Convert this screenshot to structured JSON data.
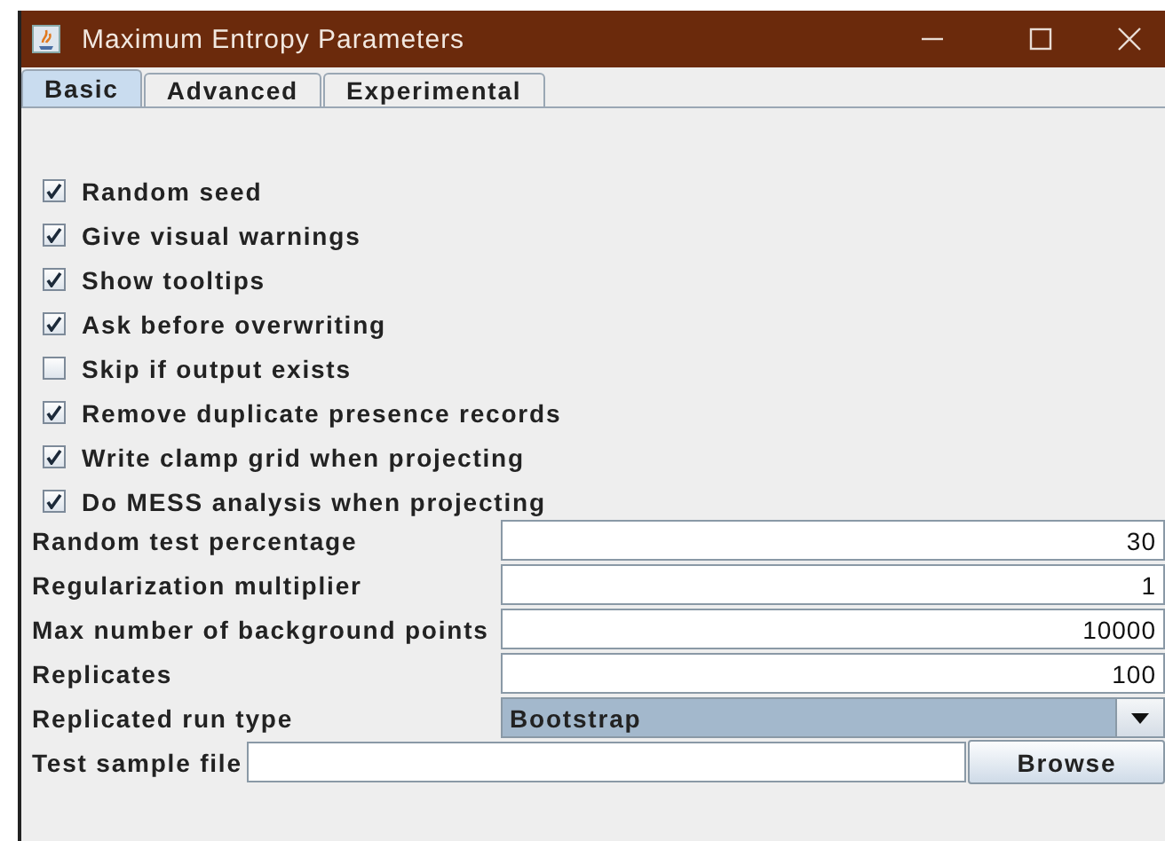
{
  "window": {
    "title": "Maximum Entropy Parameters"
  },
  "tabs": [
    {
      "label": "Basic",
      "selected": true
    },
    {
      "label": "Advanced",
      "selected": false
    },
    {
      "label": "Experimental",
      "selected": false
    }
  ],
  "checkboxes": [
    {
      "label": "Random seed",
      "checked": true
    },
    {
      "label": "Give visual warnings",
      "checked": true
    },
    {
      "label": "Show tooltips",
      "checked": true
    },
    {
      "label": "Ask before overwriting",
      "checked": true
    },
    {
      "label": "Skip if output exists",
      "checked": false
    },
    {
      "label": "Remove duplicate presence records",
      "checked": true
    },
    {
      "label": "Write clamp grid when projecting",
      "checked": true
    },
    {
      "label": "Do MESS analysis when projecting",
      "checked": true
    }
  ],
  "fields": [
    {
      "kind": "text",
      "label": "Random test percentage",
      "value": "30"
    },
    {
      "kind": "text",
      "label": "Regularization multiplier",
      "value": "1"
    },
    {
      "kind": "text",
      "label": "Max number of background points",
      "value": "10000"
    },
    {
      "kind": "text",
      "label": "Replicates",
      "value": "100"
    },
    {
      "kind": "dropdown",
      "label": "Replicated run type",
      "value": "Bootstrap"
    },
    {
      "kind": "file",
      "label": "Test sample file",
      "button": "Browse"
    }
  ]
}
